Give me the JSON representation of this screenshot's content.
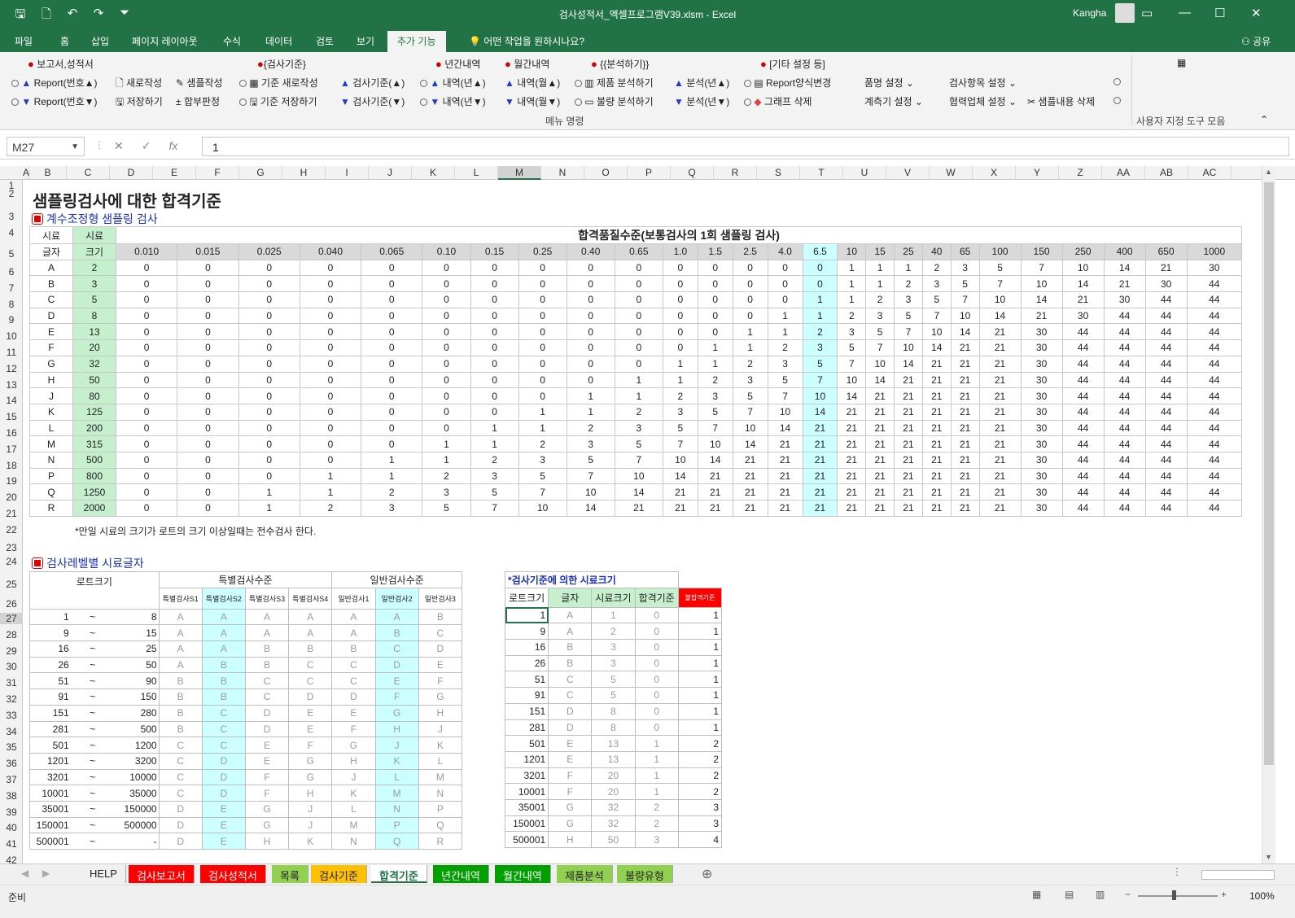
{
  "window": {
    "title": "검사성적서_엑셀프로그램V39.xlsm  -  Excel",
    "user": "Kangha",
    "restore_icon": "restore-icon",
    "min_icon": "minimize-icon",
    "max_icon": "maximize-icon",
    "close_icon": "close-icon"
  },
  "menu_tabs": [
    "파일",
    "홈",
    "삽입",
    "페이지 레이아웃",
    "수식",
    "데이터",
    "검토",
    "보기",
    "추가 기능"
  ],
  "tell_me": "어떤 작업을 원하시나요?",
  "share": "공유",
  "ribbon": {
    "group_label": "메뉴 명령",
    "custom_label": "사용자 지정 도구 모음",
    "headers": [
      "보고서,성적서",
      "{검사기준}",
      "년간내역",
      "월간내역",
      "{{분석하기}}",
      "[기타 설정 등]"
    ],
    "row1": [
      "Report(번호▲)",
      "새로작성",
      "샘플작성",
      "기준 새로작성",
      "검사기준(▲)",
      "내역(년▲)",
      "내역(월▲)",
      "제품 분석하기",
      "분석(년▲)",
      "Report양식변경",
      "품명 설정",
      "검사항목 설정"
    ],
    "row2": [
      "Report(번호▼)",
      "저장하기",
      "합부판정",
      "기준 저장하기",
      "검사기준(▼)",
      "내역(년▼)",
      "내역(월▼)",
      "불량 분석하기",
      "분석(년▼)",
      "그래프 삭제",
      "계측기 설정",
      "협력업체 설정",
      "샘플내용 삭제"
    ]
  },
  "formula": {
    "name_box": "M27",
    "value": "1"
  },
  "columns": [
    "A",
    "B",
    "C",
    "D",
    "E",
    "F",
    "G",
    "H",
    "I",
    "J",
    "K",
    "L",
    "M",
    "N",
    "O",
    "P",
    "Q",
    "R",
    "S",
    "T",
    "U",
    "V",
    "W",
    "X",
    "Y",
    "Z",
    "AA",
    "AB",
    "AC"
  ],
  "rows": [
    "1",
    "2",
    "3",
    "4",
    "5",
    "6",
    "7",
    "8",
    "9",
    "10",
    "11",
    "12",
    "13",
    "14",
    "15",
    "16",
    "17",
    "18",
    "19",
    "20",
    "21",
    "22",
    "23",
    "24",
    "25",
    "26",
    "27",
    "28",
    "29",
    "30",
    "31",
    "32",
    "33",
    "34",
    "35",
    "36",
    "37",
    "38",
    "39",
    "40",
    "41",
    "42"
  ],
  "sheet": {
    "title": "샘플링검사에 대한 합격기준",
    "section1": "계수조정형 샘플링 검사",
    "section2": "검사레벨별 시료글자",
    "note": "*만일 시료의 크기가 로트의 크기 이상일때는 전수검사 한다.",
    "aql_title": "합격품질수준(보통검사의 1회 샘플링 검사)",
    "hdr_sample_top": "시료",
    "hdr_sample_bottom": "시료",
    "hdr_letter": "글자",
    "hdr_size": "크기",
    "aql": [
      "0.010",
      "0.015",
      "0.025",
      "0.040",
      "0.065",
      "0.10",
      "0.15",
      "0.25",
      "0.40",
      "0.65",
      "1.0",
      "1.5",
      "2.5",
      "4.0",
      "6.5",
      "10",
      "15",
      "25",
      "40",
      "65",
      "100",
      "150",
      "250",
      "400",
      "650",
      "1000"
    ],
    "main_rows": [
      [
        "A",
        "2",
        "0",
        "0",
        "0",
        "0",
        "0",
        "0",
        "0",
        "0",
        "0",
        "0",
        "0",
        "0",
        "0",
        "0",
        "0",
        "1",
        "1",
        "1",
        "2",
        "3",
        "5",
        "7",
        "10",
        "14",
        "21",
        "30"
      ],
      [
        "B",
        "3",
        "0",
        "0",
        "0",
        "0",
        "0",
        "0",
        "0",
        "0",
        "0",
        "0",
        "0",
        "0",
        "0",
        "0",
        "0",
        "1",
        "1",
        "2",
        "3",
        "5",
        "7",
        "10",
        "14",
        "21",
        "30",
        "44"
      ],
      [
        "C",
        "5",
        "0",
        "0",
        "0",
        "0",
        "0",
        "0",
        "0",
        "0",
        "0",
        "0",
        "0",
        "0",
        "0",
        "0",
        "1",
        "1",
        "2",
        "3",
        "5",
        "7",
        "10",
        "14",
        "21",
        "30",
        "44",
        "44"
      ],
      [
        "D",
        "8",
        "0",
        "0",
        "0",
        "0",
        "0",
        "0",
        "0",
        "0",
        "0",
        "0",
        "0",
        "0",
        "0",
        "1",
        "1",
        "2",
        "3",
        "5",
        "7",
        "10",
        "14",
        "21",
        "30",
        "44",
        "44",
        "44"
      ],
      [
        "E",
        "13",
        "0",
        "0",
        "0",
        "0",
        "0",
        "0",
        "0",
        "0",
        "0",
        "0",
        "0",
        "0",
        "1",
        "1",
        "2",
        "3",
        "5",
        "7",
        "10",
        "14",
        "21",
        "30",
        "44",
        "44",
        "44",
        "44"
      ],
      [
        "F",
        "20",
        "0",
        "0",
        "0",
        "0",
        "0",
        "0",
        "0",
        "0",
        "0",
        "0",
        "0",
        "1",
        "1",
        "2",
        "3",
        "5",
        "7",
        "10",
        "14",
        "21",
        "21",
        "30",
        "44",
        "44",
        "44",
        "44"
      ],
      [
        "G",
        "32",
        "0",
        "0",
        "0",
        "0",
        "0",
        "0",
        "0",
        "0",
        "0",
        "0",
        "1",
        "1",
        "2",
        "3",
        "5",
        "7",
        "10",
        "14",
        "21",
        "21",
        "21",
        "30",
        "44",
        "44",
        "44",
        "44"
      ],
      [
        "H",
        "50",
        "0",
        "0",
        "0",
        "0",
        "0",
        "0",
        "0",
        "0",
        "0",
        "1",
        "1",
        "2",
        "3",
        "5",
        "7",
        "10",
        "14",
        "21",
        "21",
        "21",
        "21",
        "30",
        "44",
        "44",
        "44",
        "44"
      ],
      [
        "J",
        "80",
        "0",
        "0",
        "0",
        "0",
        "0",
        "0",
        "0",
        "0",
        "1",
        "1",
        "2",
        "3",
        "5",
        "7",
        "10",
        "14",
        "21",
        "21",
        "21",
        "21",
        "21",
        "30",
        "44",
        "44",
        "44",
        "44"
      ],
      [
        "K",
        "125",
        "0",
        "0",
        "0",
        "0",
        "0",
        "0",
        "0",
        "1",
        "1",
        "2",
        "3",
        "5",
        "7",
        "10",
        "14",
        "21",
        "21",
        "21",
        "21",
        "21",
        "21",
        "30",
        "44",
        "44",
        "44",
        "44"
      ],
      [
        "L",
        "200",
        "0",
        "0",
        "0",
        "0",
        "0",
        "0",
        "1",
        "1",
        "2",
        "3",
        "5",
        "7",
        "10",
        "14",
        "21",
        "21",
        "21",
        "21",
        "21",
        "21",
        "21",
        "30",
        "44",
        "44",
        "44",
        "44"
      ],
      [
        "M",
        "315",
        "0",
        "0",
        "0",
        "0",
        "0",
        "1",
        "1",
        "2",
        "3",
        "5",
        "7",
        "10",
        "14",
        "21",
        "21",
        "21",
        "21",
        "21",
        "21",
        "21",
        "21",
        "30",
        "44",
        "44",
        "44",
        "44"
      ],
      [
        "N",
        "500",
        "0",
        "0",
        "0",
        "0",
        "1",
        "1",
        "2",
        "3",
        "5",
        "7",
        "10",
        "14",
        "21",
        "21",
        "21",
        "21",
        "21",
        "21",
        "21",
        "21",
        "21",
        "30",
        "44",
        "44",
        "44",
        "44"
      ],
      [
        "P",
        "800",
        "0",
        "0",
        "0",
        "1",
        "1",
        "2",
        "3",
        "5",
        "7",
        "10",
        "14",
        "21",
        "21",
        "21",
        "21",
        "21",
        "21",
        "21",
        "21",
        "21",
        "21",
        "30",
        "44",
        "44",
        "44",
        "44"
      ],
      [
        "Q",
        "1250",
        "0",
        "0",
        "1",
        "1",
        "2",
        "3",
        "5",
        "7",
        "10",
        "14",
        "21",
        "21",
        "21",
        "21",
        "21",
        "21",
        "21",
        "21",
        "21",
        "21",
        "21",
        "30",
        "44",
        "44",
        "44",
        "44"
      ],
      [
        "R",
        "2000",
        "0",
        "0",
        "1",
        "2",
        "3",
        "5",
        "7",
        "10",
        "14",
        "21",
        "21",
        "21",
        "21",
        "21",
        "21",
        "21",
        "21",
        "21",
        "21",
        "21",
        "21",
        "30",
        "44",
        "44",
        "44",
        "44"
      ]
    ],
    "level": {
      "lot": "로트크기",
      "special": "특별검사수준",
      "general": "일반검사수준",
      "sub": [
        "특별검사S1",
        "특별검사S2",
        "특별검사S3",
        "특별검사S4",
        "일반검사1",
        "일반검사2",
        "일반검사3"
      ],
      "rows": [
        [
          "1",
          "~",
          "8",
          "A",
          "A",
          "A",
          "A",
          "A",
          "A",
          "B"
        ],
        [
          "9",
          "~",
          "15",
          "A",
          "A",
          "A",
          "A",
          "A",
          "B",
          "C"
        ],
        [
          "16",
          "~",
          "25",
          "A",
          "A",
          "B",
          "B",
          "B",
          "C",
          "D"
        ],
        [
          "26",
          "~",
          "50",
          "A",
          "B",
          "B",
          "C",
          "C",
          "D",
          "E"
        ],
        [
          "51",
          "~",
          "90",
          "B",
          "B",
          "C",
          "C",
          "C",
          "E",
          "F"
        ],
        [
          "91",
          "~",
          "150",
          "B",
          "B",
          "C",
          "D",
          "D",
          "F",
          "G"
        ],
        [
          "151",
          "~",
          "280",
          "B",
          "C",
          "D",
          "E",
          "E",
          "G",
          "H"
        ],
        [
          "281",
          "~",
          "500",
          "B",
          "C",
          "D",
          "E",
          "F",
          "H",
          "J"
        ],
        [
          "501",
          "~",
          "1200",
          "C",
          "C",
          "E",
          "F",
          "G",
          "J",
          "K"
        ],
        [
          "1201",
          "~",
          "3200",
          "C",
          "D",
          "E",
          "G",
          "H",
          "K",
          "L"
        ],
        [
          "3201",
          "~",
          "10000",
          "C",
          "D",
          "F",
          "G",
          "J",
          "L",
          "M"
        ],
        [
          "10001",
          "~",
          "35000",
          "C",
          "D",
          "F",
          "H",
          "K",
          "M",
          "N"
        ],
        [
          "35001",
          "~",
          "150000",
          "D",
          "E",
          "G",
          "J",
          "L",
          "N",
          "P"
        ],
        [
          "150001",
          "~",
          "500000",
          "D",
          "E",
          "G",
          "J",
          "M",
          "P",
          "Q"
        ],
        [
          "500001",
          "~",
          "-",
          "D",
          "E",
          "H",
          "K",
          "N",
          "Q",
          "R"
        ]
      ]
    },
    "std": {
      "title": "*검사기준에 의한 시료크기",
      "headers": [
        "로트크기",
        "글자",
        "시료크기",
        "합격기준",
        "불합격기준"
      ],
      "rows": [
        [
          "1",
          "A",
          "1",
          "0",
          "1"
        ],
        [
          "9",
          "A",
          "2",
          "0",
          "1"
        ],
        [
          "16",
          "B",
          "3",
          "0",
          "1"
        ],
        [
          "26",
          "B",
          "3",
          "0",
          "1"
        ],
        [
          "51",
          "C",
          "5",
          "0",
          "1"
        ],
        [
          "91",
          "C",
          "5",
          "0",
          "1"
        ],
        [
          "151",
          "D",
          "8",
          "0",
          "1"
        ],
        [
          "281",
          "D",
          "8",
          "0",
          "1"
        ],
        [
          "501",
          "E",
          "13",
          "1",
          "2"
        ],
        [
          "1201",
          "E",
          "13",
          "1",
          "2"
        ],
        [
          "3201",
          "F",
          "20",
          "1",
          "2"
        ],
        [
          "10001",
          "F",
          "20",
          "1",
          "2"
        ],
        [
          "35001",
          "G",
          "32",
          "2",
          "3"
        ],
        [
          "150001",
          "G",
          "32",
          "2",
          "3"
        ],
        [
          "500001",
          "H",
          "50",
          "3",
          "4"
        ]
      ]
    }
  },
  "sheet_tabs": [
    {
      "label": "HELP",
      "bg": "#f0f0f0",
      "fg": "#222"
    },
    {
      "label": "검사보고서",
      "bg": "#ff0000",
      "fg": "#ffffff"
    },
    {
      "label": "검사성적서",
      "bg": "#ff0000",
      "fg": "#ffffff"
    },
    {
      "label": "목록",
      "bg": "#92d050",
      "fg": "#222"
    },
    {
      "label": "검사기준",
      "bg": "#ffc000",
      "fg": "#222"
    },
    {
      "label": "합격기준",
      "bg": "#ffffff",
      "fg": "#217346"
    },
    {
      "label": "년간내역",
      "bg": "#00a000",
      "fg": "#ffffff"
    },
    {
      "label": "월간내역",
      "bg": "#00a000",
      "fg": "#ffffff"
    },
    {
      "label": "제품분석",
      "bg": "#92d050",
      "fg": "#222"
    },
    {
      "label": "불량유형",
      "bg": "#92d050",
      "fg": "#222"
    }
  ],
  "status": {
    "ready": "준비",
    "zoom": "100%"
  }
}
